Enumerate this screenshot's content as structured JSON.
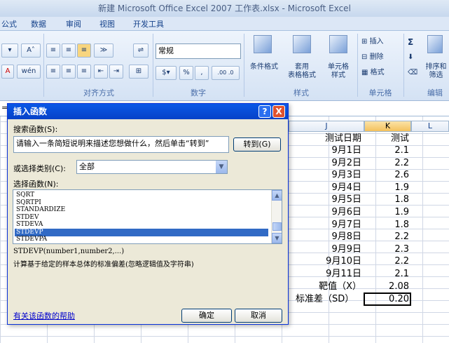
{
  "window_title": "新建 Microsoft Office Excel 2007 工作表.xlsx - Microsoft Excel",
  "menu": [
    "公式",
    "数据",
    "审阅",
    "视图",
    "开发工具"
  ],
  "ribbon": {
    "font_grow": "A",
    "font_shrink": "A",
    "groups": [
      "对齐方式",
      "数字",
      "样式",
      "单元格",
      "编辑"
    ],
    "number_format": "常规",
    "number_symbols": {
      "percent": "%",
      "comma": ",",
      "inc_dec": ".00 .0"
    },
    "conditional_format": "条件格式",
    "table_format": "套用\n表格格式",
    "cell_styles": "单元格\n样式",
    "insert": "插入",
    "delete": "删除",
    "format": "格式",
    "sort_filter": "排序和\n筛选",
    "sigma": "Σ"
  },
  "formula_bar": {
    "equals": "="
  },
  "dialog": {
    "title": "插入函数",
    "help_btn": "?",
    "close_btn": "X",
    "search_label": "搜索函数(S):",
    "search_value": "请输入一条简短说明来描述您想做什么，然后单击“转到”",
    "go_btn": "转到(G)",
    "category_label": "或选择类别(C):",
    "category_value": "全部",
    "select_label": "选择函数(N):",
    "functions": [
      "SQRT",
      "SQRTPI",
      "STANDARDIZE",
      "STDEV",
      "STDEVA",
      "STDEVP",
      "STDEVPA"
    ],
    "selected_index": 5,
    "syntax": "STDEVP(number1,number2,...)",
    "description": "计算基于给定的样本总体的标准偏差(忽略逻辑值及字符串)",
    "help_link": "有关该函数的帮助",
    "ok_btn": "确定",
    "cancel_btn": "取消"
  },
  "sheet": {
    "columns": [
      "J",
      "K",
      "L"
    ],
    "header_j": "测试日期",
    "header_k": "测试",
    "rows": [
      {
        "date": "9月1日",
        "value": "2.1"
      },
      {
        "date": "9月2日",
        "value": "2.2"
      },
      {
        "date": "9月3日",
        "value": "2.6"
      },
      {
        "date": "9月4日",
        "value": "1.9"
      },
      {
        "date": "9月5日",
        "value": "1.8"
      },
      {
        "date": "9月6日",
        "value": "1.9"
      },
      {
        "date": "9月7日",
        "value": "1.8"
      },
      {
        "date": "9月8日",
        "value": "2.2"
      },
      {
        "date": "9月9日",
        "value": "2.3"
      },
      {
        "date": "9月10日",
        "value": "2.2"
      },
      {
        "date": "9月11日",
        "value": "2.1"
      }
    ],
    "target_label": "靶值（X）",
    "target_value": "2.08",
    "sd_label": "标准差（SD）",
    "sd_value": "0.20"
  }
}
